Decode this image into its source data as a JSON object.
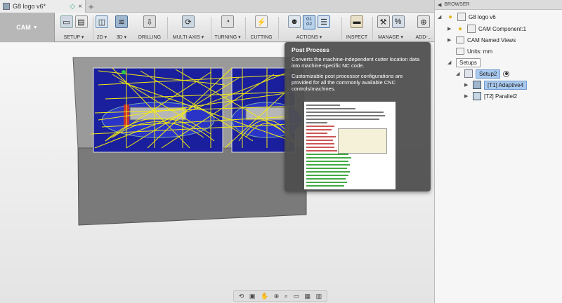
{
  "document": {
    "tab_title": "G8 logo v6*",
    "new_tab_symbol": "+",
    "close_symbol": "×",
    "sync_symbol": "◇"
  },
  "toolbar": {
    "workspace": "CAM",
    "groups": [
      {
        "label": "SETUP ▾"
      },
      {
        "label": "2D ▾"
      },
      {
        "label": "3D ▾"
      },
      {
        "label": "DRILLING"
      },
      {
        "label": "MULTI-AXIS ▾"
      },
      {
        "label": "TURNING ▾"
      },
      {
        "label": "CUTTING"
      },
      {
        "label": "ACTIONS ▾"
      },
      {
        "label": "INSPECT"
      },
      {
        "label": "MANAGE ▾"
      },
      {
        "label": "ADD-..."
      }
    ],
    "post_process_icon_text": [
      "G1",
      "G2"
    ]
  },
  "tooltip": {
    "title": "Post Process",
    "paragraph1": "Converts the machine-independent cutter location data into machine-specific NC code.",
    "paragraph2": "Customizable post processor configurations are provided for all the commonly available CNC controls/machines."
  },
  "browser": {
    "header": "BROWSER",
    "items": [
      {
        "label": "G8 logo v6"
      },
      {
        "label": "CAM Component:1"
      },
      {
        "label": "CAM Named Views"
      },
      {
        "label": "Units: mm"
      },
      {
        "label": "Setups"
      },
      {
        "label": "Setup2"
      },
      {
        "label": "[T1] Adaptive4"
      },
      {
        "label": "[T2] Parallel2"
      }
    ]
  },
  "colors": {
    "toolpath_yellow": "#f2ea12",
    "stock_blue": "#1c2bb8",
    "part_grey": "#8a8a8a",
    "selection_blue": "#a9c9ef",
    "tooltip_bg": "#4e4e4e"
  }
}
